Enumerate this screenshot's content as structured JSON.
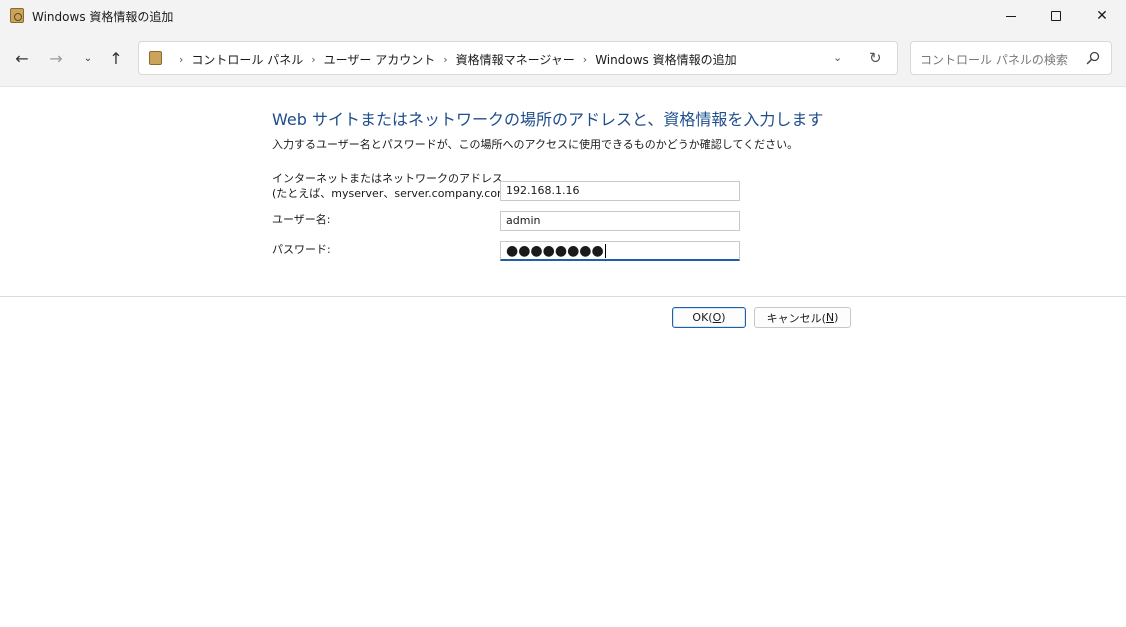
{
  "window": {
    "title": "Windows 資格情報の追加",
    "minimize_glyph": "—",
    "maximize_glyph": "☐",
    "close_glyph": "✕"
  },
  "nav": {
    "back_glyph": "←",
    "forward_glyph": "→",
    "recent_glyph": "⌄",
    "up_glyph": "↑"
  },
  "address_bar": {
    "crumbs": [
      "コントロール パネル",
      "ユーザー アカウント",
      "資格情報マネージャー",
      "Windows 資格情報の追加"
    ],
    "separator": "›",
    "dropdown_glyph": "⌄",
    "refresh_glyph": "↻"
  },
  "search": {
    "placeholder": "コントロール パネルの検索"
  },
  "form": {
    "heading": "Web サイトまたはネットワークの場所のアドレスと、資格情報を入力します",
    "instruction": "入力するユーザー名とパスワードが、この場所へのアクセスに使用できるものかどうか確認してください。",
    "address_label_line1": "インターネットまたはネットワークのアドレス",
    "address_label_line2": "(たとえば、myserver、server.company.com):",
    "address_value": "192.168.1.16",
    "username_label": "ユーザー名:",
    "username_value": "admin",
    "password_label": "パスワード:",
    "password_mask": "●●●●●●●●"
  },
  "buttons": {
    "ok_prefix": "OK(",
    "ok_key": "O",
    "ok_suffix": ")",
    "cancel_prefix": "キャンセル(",
    "cancel_key": "N",
    "cancel_suffix": ")"
  },
  "icons": {
    "app": "credential-manager-icon",
    "search": "search-icon"
  }
}
